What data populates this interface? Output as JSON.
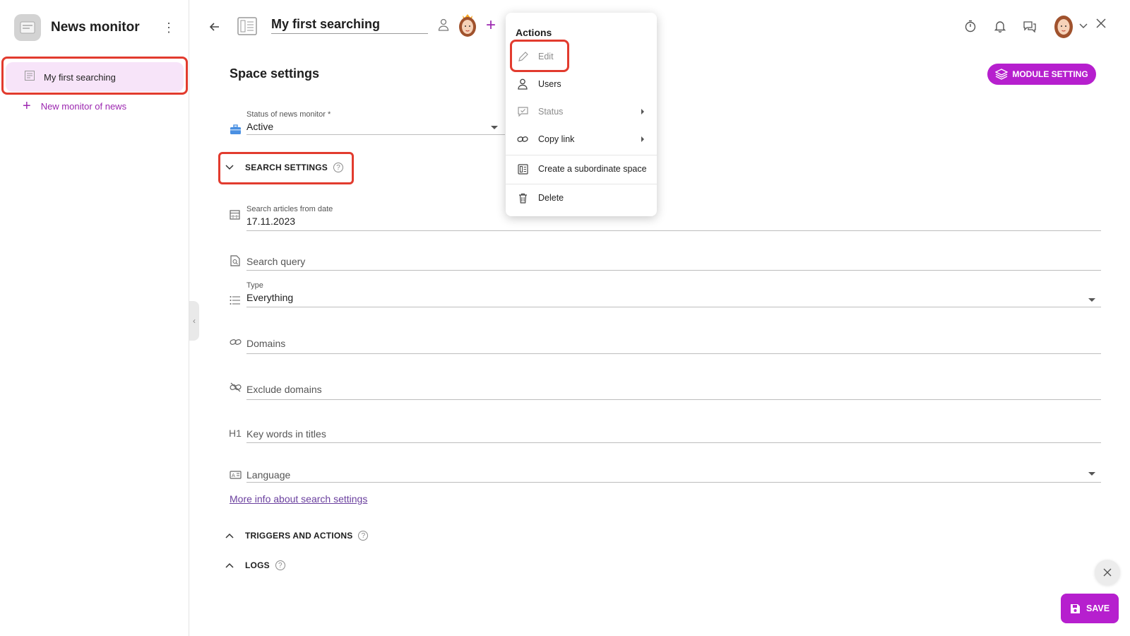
{
  "app": {
    "title": "News monitor"
  },
  "sidebar": {
    "items": [
      {
        "label": "My first searching"
      }
    ],
    "new_item_label": "New monitor of news"
  },
  "topbar": {
    "title": "My first searching"
  },
  "main": {
    "heading": "Space settings",
    "module_button": "MODULE SETTING",
    "status": {
      "label": "Status of news monitor",
      "required_mark": "*",
      "value": "Active"
    },
    "sections": {
      "search": "SEARCH SETTINGS",
      "triggers": "TRIGGERS AND ACTIONS",
      "logs": "LOGS"
    },
    "fields": {
      "from_date": {
        "label": "Search articles from date",
        "value": "17.11.2023"
      },
      "query": {
        "placeholder": "Search query"
      },
      "type": {
        "label": "Type",
        "value": "Everything"
      },
      "domains": {
        "placeholder": "Domains"
      },
      "exclude_domains": {
        "placeholder": "Exclude domains"
      },
      "keywords": {
        "icon_text": "H1",
        "placeholder": "Key words in titles"
      },
      "language": {
        "placeholder": "Language"
      }
    },
    "info_link": "More info about search settings",
    "help_glyph": "?"
  },
  "menu": {
    "title": "Actions",
    "items": [
      {
        "label": "Edit"
      },
      {
        "label": "Users"
      },
      {
        "label": "Status"
      },
      {
        "label": "Copy link"
      },
      {
        "label": "Create a subordinate space"
      },
      {
        "label": "Delete"
      }
    ]
  },
  "footer": {
    "save_label": "SAVE"
  },
  "colors": {
    "accent": "#b61fce",
    "highlight": "#e23b2e",
    "selected_bg": "#f7e4f9",
    "link": "#6a3f9e"
  }
}
